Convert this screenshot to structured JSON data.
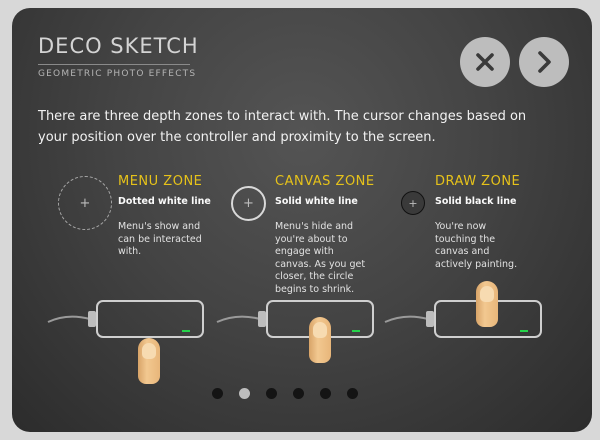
{
  "header": {
    "title": "DECO SKETCH",
    "subtitle": "GEOMETRIC PHOTO EFFECTS"
  },
  "controls": {
    "close_icon": "close-icon",
    "next_icon": "chevron-right-icon"
  },
  "intro": "There are three depth zones to interact with. The cursor changes based on your position over the controller and proximity to the screen.",
  "zones": [
    {
      "title": "MENU ZONE",
      "subtitle": "Dotted white line",
      "description": "Menu's show and can be interacted with."
    },
    {
      "title": "CANVAS ZONE",
      "subtitle": "Solid white line",
      "description": "Menu's hide and you're about to engage with canvas. As you get closer, the circle begins to shrink."
    },
    {
      "title": "DRAW ZONE",
      "subtitle": "Solid black line",
      "description": "You're now touching the canvas and actively painting."
    }
  ],
  "pagination": {
    "total": 6,
    "active_index": 1
  },
  "colors": {
    "zone_title": "#e6c21a",
    "led": "#25d24a",
    "button_bg": "#bdbdbd"
  }
}
